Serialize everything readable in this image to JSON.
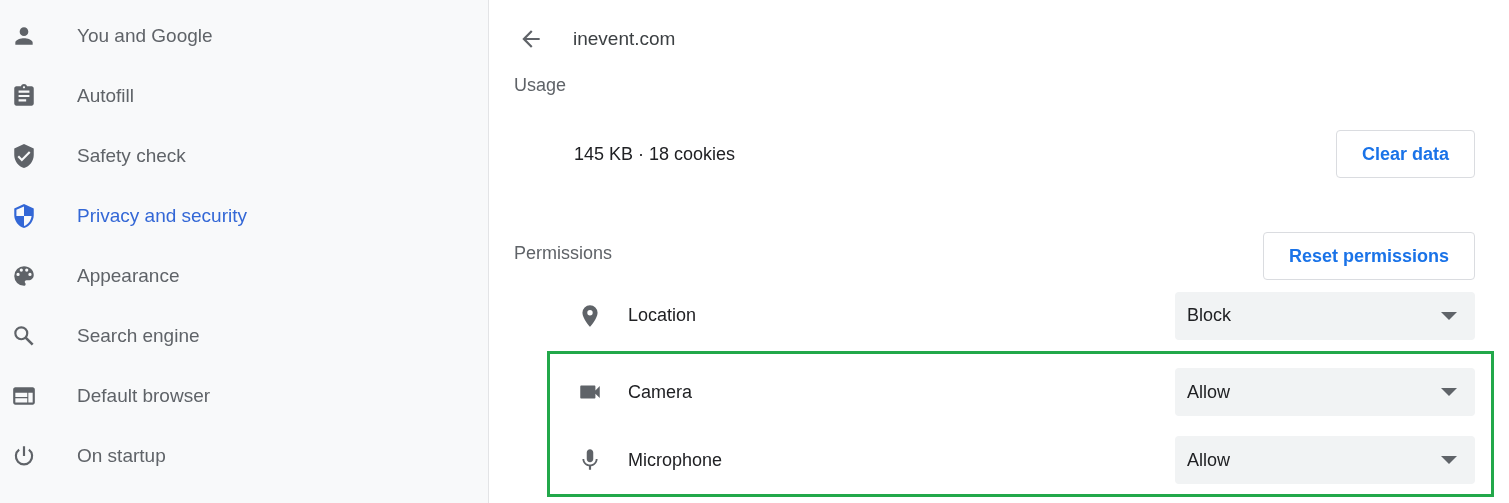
{
  "sidebar": {
    "items": [
      {
        "label": "You and Google",
        "selected": false
      },
      {
        "label": "Autofill",
        "selected": false
      },
      {
        "label": "Safety check",
        "selected": false
      },
      {
        "label": "Privacy and security",
        "selected": true
      },
      {
        "label": "Appearance",
        "selected": false
      },
      {
        "label": "Search engine",
        "selected": false
      },
      {
        "label": "Default browser",
        "selected": false
      },
      {
        "label": "On startup",
        "selected": false
      }
    ]
  },
  "page": {
    "title": "inevent.com",
    "usage": {
      "heading": "Usage",
      "summary": "145 KB · 18 cookies",
      "button": "Clear data"
    },
    "permissions": {
      "heading": "Permissions",
      "button": "Reset permissions",
      "items": [
        {
          "label": "Location",
          "value": "Block"
        }
      ],
      "highlight_box": {
        "items": [
          {
            "label": "Camera",
            "value": "Allow"
          },
          {
            "label": "Microphone",
            "value": "Allow"
          }
        ]
      }
    }
  }
}
